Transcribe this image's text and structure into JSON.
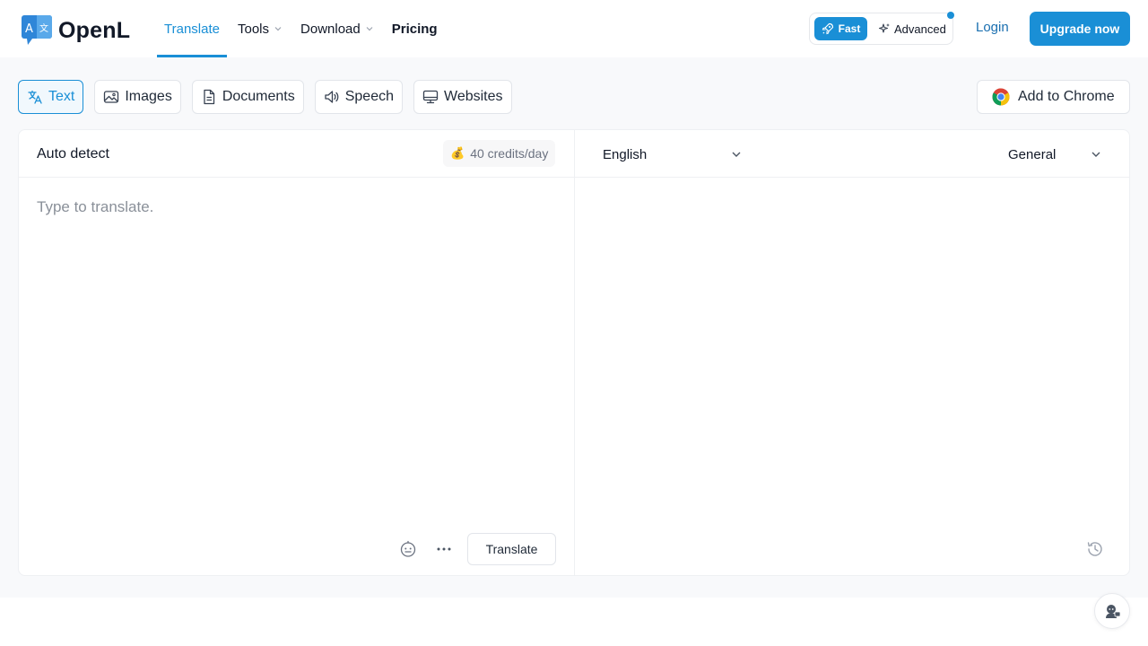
{
  "app": {
    "logo_text": "OpenL",
    "logo_letters": [
      "A",
      "文"
    ],
    "brand_color": "#1a8fd6"
  },
  "nav": {
    "items": [
      {
        "label": "Translate",
        "active": true
      },
      {
        "label": "Tools",
        "has_dropdown": true
      },
      {
        "label": "Download",
        "has_dropdown": true
      },
      {
        "label": "Pricing",
        "bold": true
      }
    ]
  },
  "mode": {
    "fast_label": "Fast",
    "advanced_label": "Advanced",
    "selected": "Fast"
  },
  "auth": {
    "login_label": "Login",
    "upgrade_label": "Upgrade now"
  },
  "media_tabs": [
    {
      "label": "Text",
      "icon": "translate-icon",
      "active": true
    },
    {
      "label": "Images",
      "icon": "image-icon"
    },
    {
      "label": "Documents",
      "icon": "document-icon"
    },
    {
      "label": "Speech",
      "icon": "speaker-icon"
    },
    {
      "label": "Websites",
      "icon": "monitor-icon"
    }
  ],
  "extension": {
    "label": "Add to Chrome",
    "icon": "chrome-icon"
  },
  "source": {
    "language": "Auto detect",
    "credits": "40 credits/day",
    "credits_icon": "money-bag-icon",
    "placeholder": "Type to translate.",
    "value": ""
  },
  "target": {
    "language": "English",
    "tone": "General"
  },
  "actions": {
    "translate_label": "Translate"
  }
}
